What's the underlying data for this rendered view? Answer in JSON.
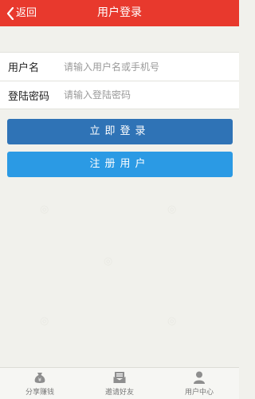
{
  "header": {
    "back_label": "返回",
    "title": "用户登录",
    "color": "#e8392d"
  },
  "form": {
    "username": {
      "label": "用户名",
      "placeholder": "请输入用户名或手机号",
      "value": ""
    },
    "password": {
      "label": "登陆密码",
      "placeholder": "请输入登陆密码",
      "value": ""
    }
  },
  "buttons": {
    "login_label": "立即登录",
    "login_color": "#2f73b6",
    "register_label": "注册用户",
    "register_color": "#2b9ae4"
  },
  "tabbar": {
    "items": [
      {
        "label": "分享赚钱",
        "icon": "money-bag-icon"
      },
      {
        "label": "邀请好友",
        "icon": "invite-envelope-icon"
      },
      {
        "label": "用户中心",
        "icon": "user-icon"
      }
    ]
  }
}
